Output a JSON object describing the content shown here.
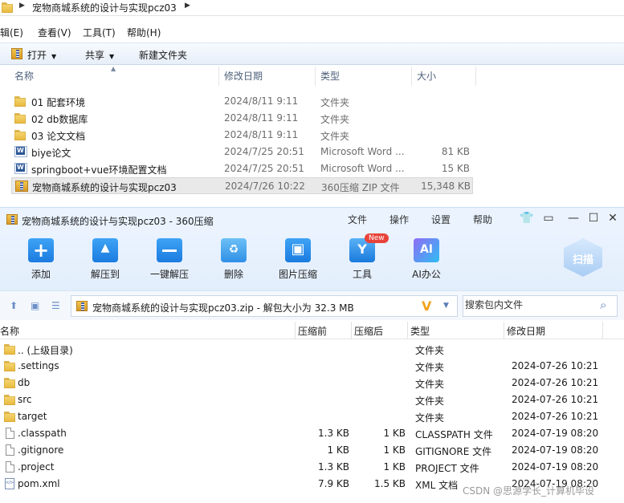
{
  "explorer": {
    "breadcrumb": "宠物商城系统的设计与实现pcz03",
    "menu": [
      "辑(E)",
      "查看(V)",
      "工具(T)",
      "帮助(H)"
    ],
    "toolbar": {
      "open": "打开",
      "share": "共享",
      "new_folder": "新建文件夹"
    },
    "columns": [
      "名称",
      "修改日期",
      "类型",
      "大小"
    ],
    "rows": [
      {
        "name": "01 配套环境",
        "date": "2024/8/11 9:11",
        "type": "文件夹",
        "size": "",
        "icon": "folder-icon"
      },
      {
        "name": "02 db数据库",
        "date": "2024/8/11 9:11",
        "type": "文件夹",
        "size": "",
        "icon": "folder-icon"
      },
      {
        "name": "03 论文文档",
        "date": "2024/8/11 9:11",
        "type": "文件夹",
        "size": "",
        "icon": "folder-icon"
      },
      {
        "name": "biye论文",
        "date": "2024/7/25 20:51",
        "type": "Microsoft Word ...",
        "size": "81 KB",
        "icon": "word-doc-icon"
      },
      {
        "name": "springboot+vue环境配置文档",
        "date": "2024/7/25 20:51",
        "type": "Microsoft Word ...",
        "size": "15 KB",
        "icon": "word-doc-icon"
      },
      {
        "name": "宠物商城系统的设计与实现pcz03",
        "date": "2024/7/26 10:22",
        "type": "360压缩 ZIP 文件",
        "size": "15,348 KB",
        "icon": "zip-archive-icon"
      }
    ]
  },
  "zipwin": {
    "title": "宠物商城系统的设计与实现pcz03 - 360压缩",
    "menu": [
      "文件",
      "操作",
      "设置",
      "帮助"
    ],
    "ribbon": [
      {
        "label": "添加",
        "icon": "add-icon"
      },
      {
        "label": "解压到",
        "icon": "extract-to-icon"
      },
      {
        "label": "一键解压",
        "icon": "one-click-extract-icon"
      },
      {
        "label": "删除",
        "icon": "delete-icon"
      },
      {
        "label": "图片压缩",
        "icon": "image-compress-icon"
      },
      {
        "label": "工具",
        "icon": "tools-icon"
      },
      {
        "label": "AI办公",
        "icon": "ai-office-icon"
      }
    ],
    "new_badge": "New",
    "scan_label": "扫描",
    "path_text": "宠物商城系统的设计与实现pcz03.zip - 解包大小为 32.3 MB",
    "search_placeholder": "搜索包内文件",
    "columns": [
      "名称",
      "压缩前",
      "压缩后",
      "类型",
      "修改日期"
    ],
    "rows": [
      {
        "name": ".. (上级目录)",
        "before": "",
        "after": "",
        "type": "文件夹",
        "date": "",
        "icon": "folder-icon"
      },
      {
        "name": ".settings",
        "before": "",
        "after": "",
        "type": "文件夹",
        "date": "2024-07-26 10:21",
        "icon": "folder-icon"
      },
      {
        "name": "db",
        "before": "",
        "after": "",
        "type": "文件夹",
        "date": "2024-07-26 10:21",
        "icon": "folder-icon"
      },
      {
        "name": "src",
        "before": "",
        "after": "",
        "type": "文件夹",
        "date": "2024-07-26 10:21",
        "icon": "folder-icon"
      },
      {
        "name": "target",
        "before": "",
        "after": "",
        "type": "文件夹",
        "date": "2024-07-26 10:21",
        "icon": "folder-icon"
      },
      {
        "name": ".classpath",
        "before": "1.3 KB",
        "after": "1 KB",
        "type": "CLASSPATH 文件",
        "date": "2024-07-19 08:20",
        "icon": "file-icon"
      },
      {
        "name": ".gitignore",
        "before": "1 KB",
        "after": "1 KB",
        "type": "GITIGNORE 文件",
        "date": "2024-07-19 08:20",
        "icon": "file-icon"
      },
      {
        "name": ".project",
        "before": "1.3 KB",
        "after": "1 KB",
        "type": "PROJECT 文件",
        "date": "2024-07-19 08:20",
        "icon": "file-icon"
      },
      {
        "name": "pom.xml",
        "before": "7.9 KB",
        "after": "1.5 KB",
        "type": "XML 文档",
        "date": "2024-07-19 08:20",
        "icon": "xml-file-icon"
      }
    ]
  },
  "watermark": "CSDN @思源学长_计算机毕设"
}
